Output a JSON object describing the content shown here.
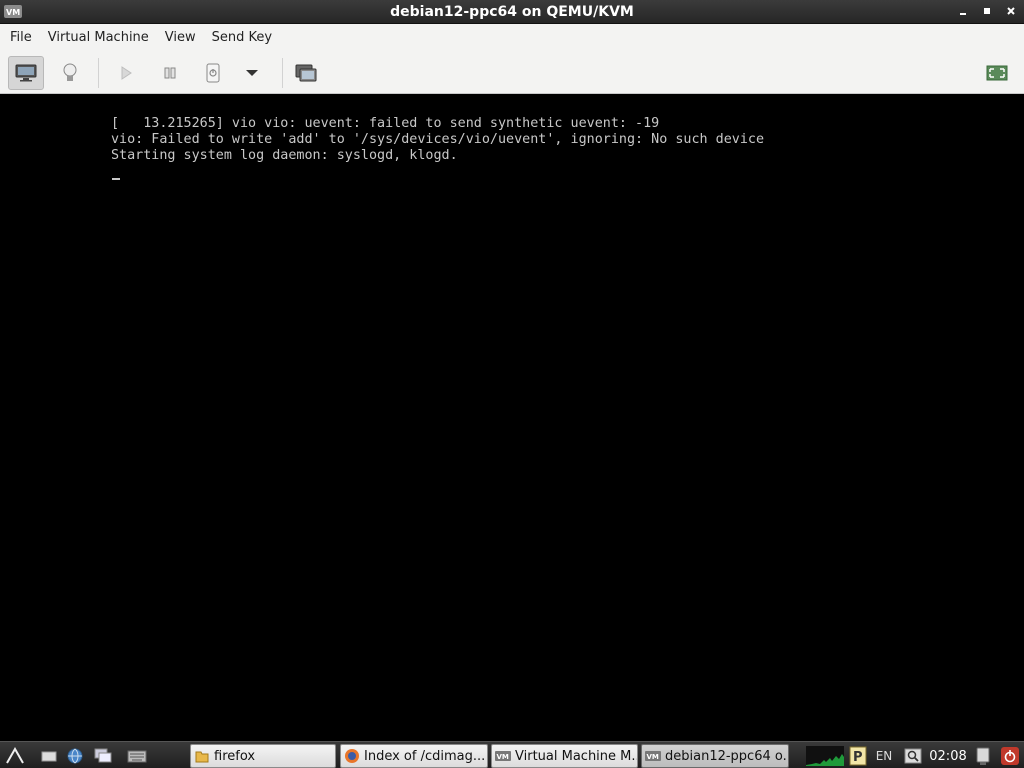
{
  "window": {
    "title": "debian12-ppc64 on QEMU/KVM"
  },
  "menubar": {
    "items": [
      "File",
      "Virtual Machine",
      "View",
      "Send Key"
    ]
  },
  "toolbar": {
    "icons": [
      "monitor-icon",
      "lightbulb-icon",
      "play-icon",
      "pause-icon",
      "power-icon",
      "dropdown-arrow-icon",
      "screenshot-icon",
      "fullscreen-icon"
    ]
  },
  "console": {
    "lines": [
      "[   13.215265] vio vio: uevent: failed to send synthetic uevent: -19",
      "vio: Failed to write 'add' to '/sys/devices/vio/uevent', ignoring: No such device",
      "Starting system log daemon: syslogd, klogd."
    ]
  },
  "taskbar": {
    "tasks": [
      {
        "label": "firefox",
        "icon": "folder-icon"
      },
      {
        "label": "Index of /cdimag...",
        "icon": "firefox-icon"
      },
      {
        "label": "Virtual Machine M...",
        "icon": "virt-manager-icon"
      },
      {
        "label": "debian12-ppc64 o...",
        "icon": "virt-manager-icon"
      }
    ],
    "tray": {
      "lang": "EN",
      "clock": "02:08"
    }
  },
  "colors": {
    "console_bg": "#000000",
    "console_text": "#c8c8c8",
    "chrome_bg": "#f3f3f2",
    "titlebar_bg": "#2f2f2f"
  }
}
